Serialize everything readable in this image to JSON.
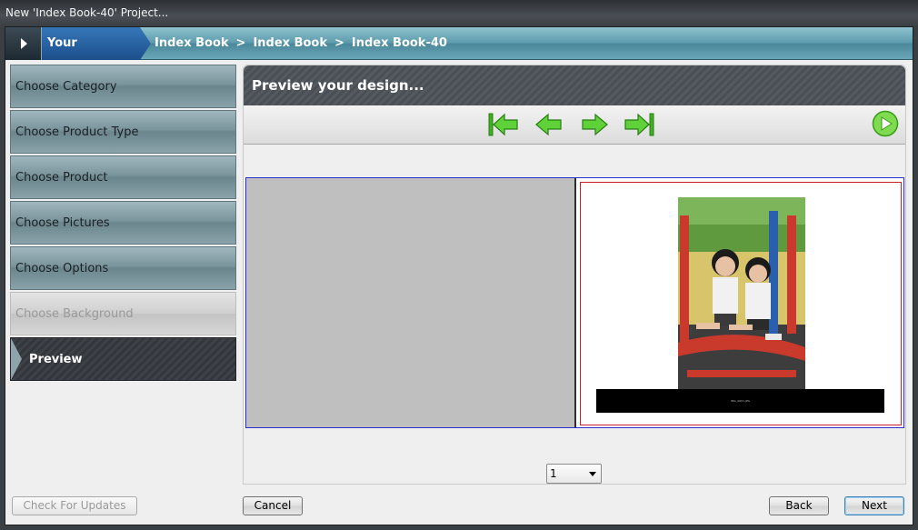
{
  "window": {
    "title": "New 'Index Book-40' Project..."
  },
  "breadcrumb": {
    "label": "Your Selections:",
    "items": [
      "Index Book",
      "Index Book",
      "Index Book-40"
    ],
    "separator": ">"
  },
  "steps": [
    {
      "label": "Choose Category",
      "state": "normal"
    },
    {
      "label": "Choose Product Type",
      "state": "normal"
    },
    {
      "label": "Choose Product",
      "state": "normal"
    },
    {
      "label": "Choose Pictures",
      "state": "normal"
    },
    {
      "label": "Choose Options",
      "state": "normal"
    },
    {
      "label": "Choose Background",
      "state": "disabled"
    },
    {
      "label": "Preview",
      "state": "active"
    }
  ],
  "panel": {
    "title": "Preview your design...",
    "nav_icons": [
      "first-page-icon",
      "previous-page-icon",
      "next-page-icon",
      "last-page-icon",
      "play-icon"
    ],
    "caption_text": "IMG_0001.JPG"
  },
  "page_select": {
    "value": "1"
  },
  "buttons": {
    "check_updates": "Check For Updates",
    "cancel": "Cancel",
    "back": "Back",
    "next": "Next"
  },
  "colors": {
    "accent_blue": "#1d4f8c",
    "nav_green": "#4fc22a",
    "spread_border": "#2a2fcf",
    "page_border": "#c8202a"
  }
}
